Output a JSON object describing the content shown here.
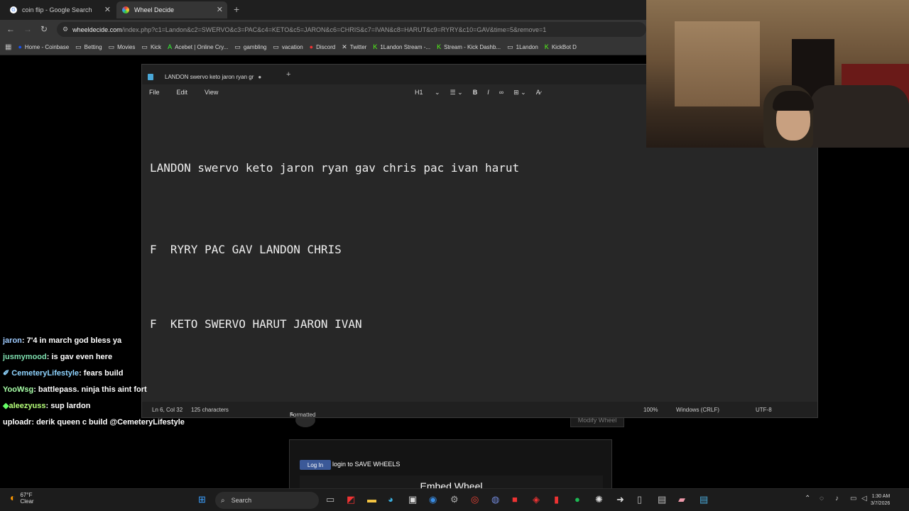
{
  "browser": {
    "tabs": [
      {
        "label": "coin flip - Google Search",
        "active": false
      },
      {
        "label": "Wheel Decide",
        "active": true
      }
    ],
    "url_host": "wheeldecide.com",
    "url_path": "/index.php?c1=Landon&c2=SWERVO&c3=PAC&c4=KETO&c5=JARON&c6=CHRIS&c7=IVAN&c8=HARUT&c9=RYRY&c10=GAV&time=5&remove=1",
    "bookmarks": [
      {
        "label": "Home - Coinbase",
        "icon": "coinbase-icon"
      },
      {
        "label": "Betting",
        "icon": "folder-icon"
      },
      {
        "label": "Movies",
        "icon": "folder-icon"
      },
      {
        "label": "Kick",
        "icon": "folder-icon"
      },
      {
        "label": "Acebet | Online Cry...",
        "icon": "acebet-icon"
      },
      {
        "label": "gambling",
        "icon": "folder-icon"
      },
      {
        "label": "vacation",
        "icon": "folder-icon"
      },
      {
        "label": "Discord",
        "icon": "discord-icon"
      },
      {
        "label": "Twitter",
        "icon": "x-icon"
      },
      {
        "label": "1Landon Stream -...",
        "icon": "kick-icon"
      },
      {
        "label": "Stream - Kick Dashb...",
        "icon": "kick-icon"
      },
      {
        "label": "1Landon",
        "icon": "folder-icon"
      },
      {
        "label": "KickBot D",
        "icon": "kickbot-icon"
      }
    ]
  },
  "notepad": {
    "tab_title": "LANDON swervo keto jaron ryan gr",
    "menu": [
      "File",
      "Edit",
      "View"
    ],
    "heading_select": "H1",
    "lines": [
      "LANDON swervo keto jaron ryan gav chris pac ivan harut",
      "F  RYRY PAC GAV LANDON CHRIS",
      "F  KETO SWERVO HARUT JARON IVAN"
    ],
    "status": {
      "position": "Ln 6, Col 32",
      "chars": "125 characters",
      "format": "Formatted",
      "zoom": "100%",
      "line_ending": "Windows (CRLF)",
      "encoding": "UTF-8"
    }
  },
  "chat": [
    {
      "user": "jaron",
      "text": "7'4 in march god bless ya",
      "color": "#9ecbff"
    },
    {
      "user": "jusmymood",
      "text": "is gav even here",
      "color": "#7fe0b0"
    },
    {
      "user": "CemeteryLifestyle",
      "text": "fears build",
      "color": "#8fd4ff",
      "badge": "sword-badge"
    },
    {
      "user": "YooWsg",
      "text": "battlepass. ninja this aint fort",
      "color": "#a8ffa8"
    },
    {
      "user": "aleezyuss",
      "text": "sup lardon",
      "color": "#b6ff7a",
      "badge": "diamond-badge"
    },
    {
      "user": "uploadr",
      "text": "derik queen c build @CemeteryLifestyle",
      "color": "#ffffff"
    }
  ],
  "wheel_page": {
    "modify_label": "Modify Wheel",
    "fb_login": "Log In",
    "save_text": "login to SAVE WHEELS",
    "embed_title": "Embed Wheel"
  },
  "taskbar": {
    "temp": "67°F",
    "condition": "Clear",
    "search": "Search",
    "time": "1:30 AM",
    "date": "3/7/2026"
  }
}
